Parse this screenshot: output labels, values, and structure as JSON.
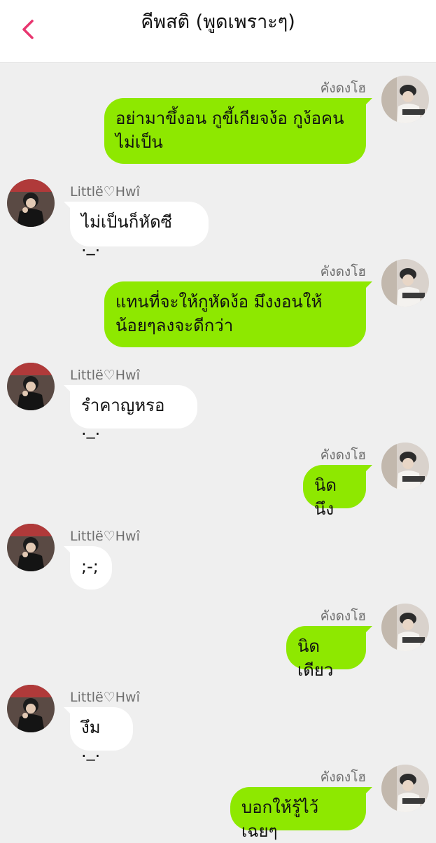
{
  "header": {
    "title": "คีพสติ (พูดเพราะๆ)",
    "back_icon": "chevron-left-icon",
    "accent_color": "#e8366f"
  },
  "colors": {
    "background": "#efefef",
    "sent_bubble": "#8ee800",
    "received_bubble": "#ffffff"
  },
  "messages": [
    {
      "side": "right",
      "sender": "คังดงโฮ",
      "text_lines": [
        "อย่ามาขึ้งอน กูขี้เกียจง้อ กูง้อคน",
        "ไม่เป็น"
      ]
    },
    {
      "side": "left",
      "sender": "Littlë♡Hwî",
      "text_lines": [
        "ไม่เป็นก็หัดซี ._."
      ]
    },
    {
      "side": "right",
      "sender": "คังดงโฮ",
      "text_lines": [
        "แทนที่จะให้กูหัดง้อ มึงงอนให้",
        "น้อยๆลงจะดีกว่า"
      ]
    },
    {
      "side": "left",
      "sender": "Littlë♡Hwî",
      "text_lines": [
        "รำคาญหรอ ._."
      ]
    },
    {
      "side": "right",
      "sender": "คังดงโฮ",
      "text_lines": [
        "นิดนึง"
      ]
    },
    {
      "side": "left",
      "sender": "Littlë♡Hwî",
      "text_lines": [
        ";-;"
      ]
    },
    {
      "side": "right",
      "sender": "คังดงโฮ",
      "text_lines": [
        "นิดเดียว"
      ]
    },
    {
      "side": "left",
      "sender": "Littlë♡Hwî",
      "text_lines": [
        "งึม ._."
      ]
    },
    {
      "side": "right",
      "sender": "คังดงโฮ",
      "text_lines": [
        "บอกให้รู้ไว้เฉยๆ"
      ]
    }
  ]
}
